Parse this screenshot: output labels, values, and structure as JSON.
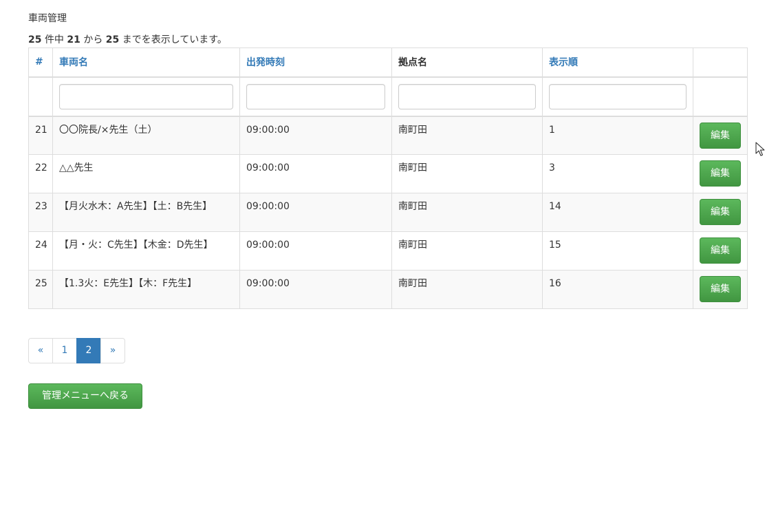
{
  "page": {
    "title": "車両管理",
    "summary": {
      "total": "25",
      "text1": "件中",
      "from": "21",
      "text2": "から",
      "to": "25",
      "text3": "までを表示しています。"
    }
  },
  "table": {
    "headers": {
      "index": "#",
      "vehicle_name": "車両名",
      "departure_time": "出発時刻",
      "base_name": "拠点名",
      "display_order": "表示順"
    },
    "filters": {
      "vehicle_name": "",
      "departure_time": "",
      "base_name": "",
      "display_order": ""
    },
    "rows": [
      {
        "index": "21",
        "vehicle_name": "〇〇院長/×先生（土）",
        "departure_time": "09:00:00",
        "base_name": "南町田",
        "display_order": "1",
        "edit_label": "編集"
      },
      {
        "index": "22",
        "vehicle_name": "△△先生",
        "departure_time": "09:00:00",
        "base_name": "南町田",
        "display_order": "3",
        "edit_label": "編集"
      },
      {
        "index": "23",
        "vehicle_name": "【月火水木：A先生】【土：B先生】",
        "departure_time": "09:00:00",
        "base_name": "南町田",
        "display_order": "14",
        "edit_label": "編集"
      },
      {
        "index": "24",
        "vehicle_name": "【月・火：C先生】【木金：D先生】",
        "departure_time": "09:00:00",
        "base_name": "南町田",
        "display_order": "15",
        "edit_label": "編集"
      },
      {
        "index": "25",
        "vehicle_name": "【1.3火：E先生】【木：F先生】",
        "departure_time": "09:00:00",
        "base_name": "南町田",
        "display_order": "16",
        "edit_label": "編集"
      }
    ]
  },
  "pagination": {
    "prev": "«",
    "pages": [
      "1",
      "2"
    ],
    "active_page": "2",
    "next": "»"
  },
  "back_button": "管理メニューへ戻る",
  "colors": {
    "link": "#337ab7",
    "success": "#5cb85c",
    "active_page": "#337ab7"
  },
  "icons": {
    "cursor": "mouse-pointer-icon"
  }
}
